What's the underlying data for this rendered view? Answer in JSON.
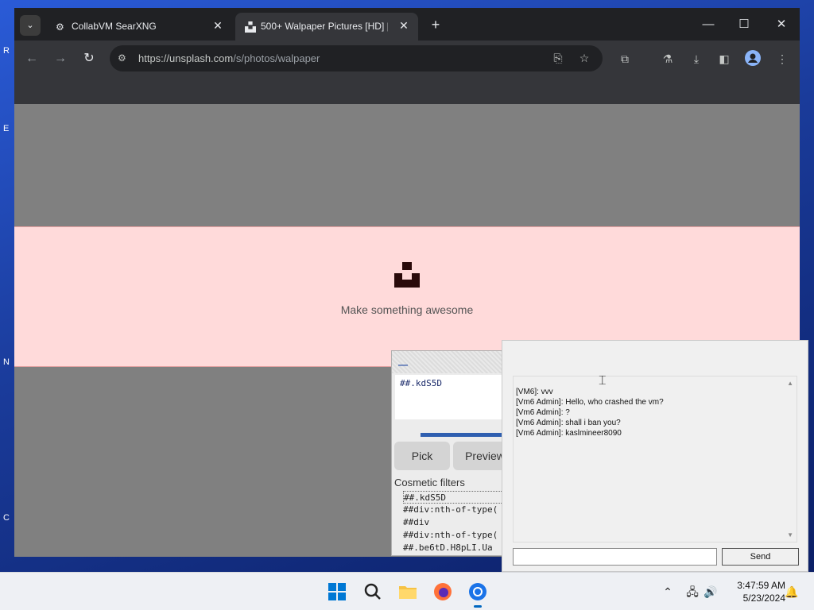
{
  "desktop": {
    "icon_letters": [
      "R",
      "E",
      "",
      "N",
      "C"
    ]
  },
  "browser": {
    "tabs": [
      {
        "title": "CollabVM SearXNG",
        "close": "✕",
        "active": false
      },
      {
        "title": "500+ Walpaper Pictures [HD] |",
        "close": "✕",
        "active": true
      }
    ],
    "new_tab": "+",
    "window_controls": {
      "minimize": "—",
      "maximize": "☐",
      "close": "✕"
    },
    "url_host": "https://unsplash.com",
    "url_path": "/s/photos/walpaper"
  },
  "page": {
    "tagline": "Make something awesome"
  },
  "picker": {
    "selector_value": "##.kdS5D",
    "pick_label": "Pick",
    "preview_label": "Preview",
    "cosmetic_label": "Cosmetic filters",
    "filters": [
      "##.kdS5D",
      "##div:nth-of-type(",
      "##div",
      "##div:nth-of-type(",
      "##.be6tD.H8pLI.Ua"
    ]
  },
  "chat": {
    "messages": [
      "[VM6]: vvv",
      "[Vm6 Admin]: Hello, who crashed the vm?",
      "[Vm6 Admin]: ?",
      "[Vm6 Admin]: shall i ban you?",
      "[Vm6 Admin]: kaslmineer8090"
    ],
    "send_label": "Send"
  },
  "taskbar": {
    "time": "3:47:59 AM",
    "date": "5/23/2024"
  },
  "colors": {
    "banner": "#ffdada",
    "page_bg": "#808080",
    "accent": "#0067c0"
  }
}
